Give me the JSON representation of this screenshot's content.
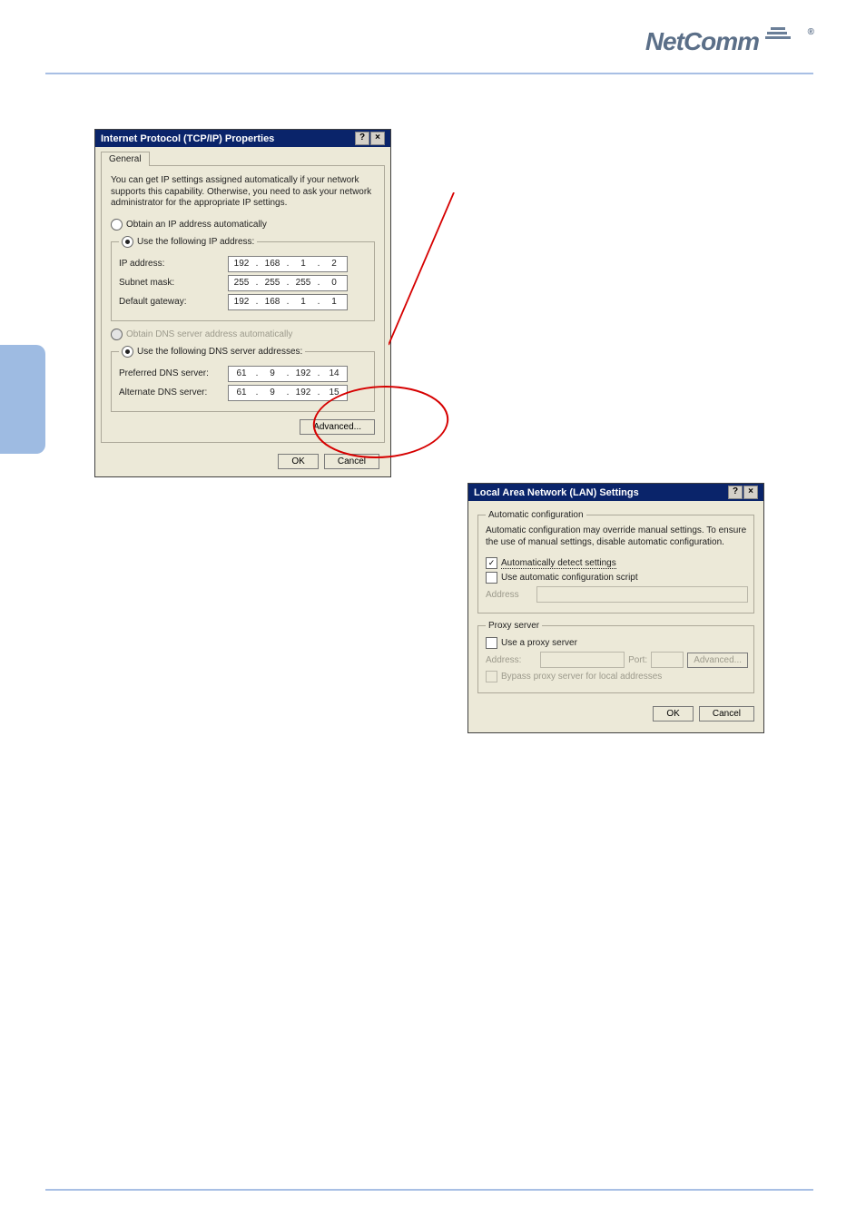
{
  "brand": {
    "name": "NetComm",
    "reg": "®"
  },
  "dialog1": {
    "title": "Internet Protocol (TCP/IP) Properties",
    "help_btn": "?",
    "close_btn": "×",
    "tab_general": "General",
    "description": "You can get IP settings assigned automatically if your network supports this capability. Otherwise, you need to ask your network administrator for the appropriate IP settings.",
    "radio_obtain_ip": "Obtain an IP address automatically",
    "radio_use_ip": "Use the following IP address:",
    "ip_label": "IP address:",
    "ip": [
      "192",
      "168",
      "1",
      "2"
    ],
    "subnet_label": "Subnet mask:",
    "subnet": [
      "255",
      "255",
      "255",
      "0"
    ],
    "gateway_label": "Default gateway:",
    "gateway": [
      "192",
      "168",
      "1",
      "1"
    ],
    "radio_obtain_dns": "Obtain DNS server address automatically",
    "radio_use_dns": "Use the following DNS server addresses:",
    "pref_dns_label": "Preferred DNS server:",
    "pref_dns": [
      "61",
      "9",
      "192",
      "14"
    ],
    "alt_dns_label": "Alternate DNS server:",
    "alt_dns": [
      "61",
      "9",
      "192",
      "15"
    ],
    "advanced_btn": "Advanced...",
    "ok_btn": "OK",
    "cancel_btn": "Cancel"
  },
  "dialog2": {
    "title": "Local Area Network (LAN) Settings",
    "help_btn": "?",
    "close_btn": "×",
    "autoconf_legend": "Automatic configuration",
    "autoconf_desc": "Automatic configuration may override manual settings. To ensure the use of manual settings, disable automatic configuration.",
    "chk_autodetect": "Automatically detect settings",
    "chk_autoscript": "Use automatic configuration script",
    "address_lbl": "Address",
    "proxy_legend": "Proxy server",
    "chk_useproxy": "Use a proxy server",
    "address2_lbl": "Address:",
    "port_lbl": "Port:",
    "adv_btn": "Advanced...",
    "chk_bypass": "Bypass proxy server for local addresses",
    "ok_btn": "OK",
    "cancel_btn": "Cancel"
  }
}
